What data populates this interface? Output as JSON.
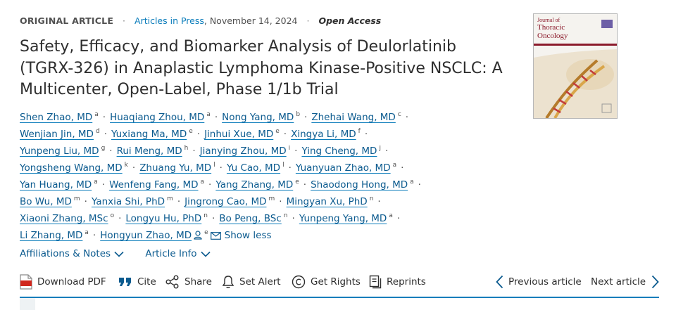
{
  "meta": {
    "article_type": "ORIGINAL ARTICLE",
    "status": "Articles in Press",
    "date": ", November 14, 2024",
    "access": "Open Access"
  },
  "title": "Safety, Efficacy, and Biomarker Analysis of Deulorlatinib (TGRX-326) in Anaplastic Lymphoma Kinase-Positive NSCLC: A Multicenter, Open-Label, Phase 1/1b Trial",
  "author_rows": [
    [
      {
        "name": "Shen Zhao, MD",
        "aff": "a"
      },
      {
        "name": "Huaqiang Zhou, MD",
        "aff": "a"
      },
      {
        "name": "Nong Yang, MD",
        "aff": "b"
      },
      {
        "name": "Zhehai Wang, MD",
        "aff": "c"
      }
    ],
    [
      {
        "name": "Wenjian Jin, MD",
        "aff": "d"
      },
      {
        "name": "Yuxiang Ma, MD",
        "aff": "e"
      },
      {
        "name": "Jinhui Xue, MD",
        "aff": "e"
      },
      {
        "name": "Xingya Li, MD",
        "aff": "f"
      }
    ],
    [
      {
        "name": "Yunpeng Liu, MD",
        "aff": "g"
      },
      {
        "name": "Rui Meng, MD",
        "aff": "h"
      },
      {
        "name": "Jianying Zhou, MD",
        "aff": "i"
      },
      {
        "name": "Ying Cheng, MD",
        "aff": "j"
      }
    ],
    [
      {
        "name": "Yongsheng Wang, MD",
        "aff": "k"
      },
      {
        "name": "Zhuang Yu, MD",
        "aff": "l"
      },
      {
        "name": "Yu Cao, MD",
        "aff": "l"
      },
      {
        "name": "Yuanyuan Zhao, MD",
        "aff": "a"
      }
    ],
    [
      {
        "name": "Yan Huang, MD",
        "aff": "a"
      },
      {
        "name": "Wenfeng Fang, MD",
        "aff": "a"
      },
      {
        "name": "Yang Zhang, MD",
        "aff": "e"
      },
      {
        "name": "Shaodong Hong, MD",
        "aff": "a"
      }
    ],
    [
      {
        "name": "Bo Wu, MD",
        "aff": "m"
      },
      {
        "name": "Yanxia Shi, PhD",
        "aff": "m"
      },
      {
        "name": "Jingrong Cao, MD",
        "aff": "m"
      },
      {
        "name": "Mingyan Xu, PhD",
        "aff": "n"
      }
    ],
    [
      {
        "name": "Xiaoni Zhang, MSc",
        "aff": "o"
      },
      {
        "name": "Longyu Hu, PhD",
        "aff": "n"
      },
      {
        "name": "Bo Peng, BSc",
        "aff": "n"
      },
      {
        "name": "Yunpeng Yang, MD",
        "aff": "a"
      }
    ]
  ],
  "last_row": {
    "author1": {
      "name": "Li Zhang, MD",
      "aff": "a"
    },
    "author2": {
      "name": "Hongyun Zhao, MD",
      "aff": "e"
    },
    "show_less": "Show less"
  },
  "cover": {
    "line1": "Journal of",
    "line2": "Thoracic",
    "line3": "Oncology",
    "brand_color": "#8b1a2b"
  },
  "links": {
    "affiliations": "Affiliations & Notes",
    "article_info": "Article Info"
  },
  "toolbar": {
    "download_pdf": "Download PDF",
    "cite": "Cite",
    "share": "Share",
    "set_alert": "Set Alert",
    "get_rights": "Get Rights",
    "reprints": "Reprints",
    "previous": "Previous article",
    "next": "Next article"
  },
  "colors": {
    "link": "#0c5b8f",
    "accent": "#0c7dbb",
    "pdf_red": "#d0271d"
  },
  "icons": [
    "pdf-icon",
    "cite-quote-icon",
    "share-icon",
    "bell-alert-icon",
    "copyright-icon",
    "reprints-icon",
    "chevron-left-icon",
    "chevron-right-icon",
    "person-icon",
    "mail-icon",
    "chevron-down-icon"
  ]
}
